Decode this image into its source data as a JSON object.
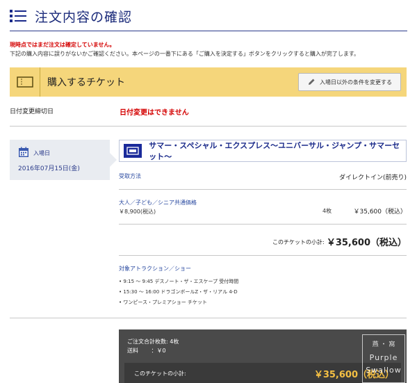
{
  "header": {
    "title": "注文内容の確認",
    "icon": "list-icon",
    "accent_color": "#1a2a7a"
  },
  "notice": {
    "warning": "現時点ではまだ注文は確定していません。",
    "instruction": "下記の購入内容に誤りがないかご確認ください。本ページの一番下にある「ご購入を決定する」ボタンをクリックすると購入が完了します。",
    "warning_color": "#d40000"
  },
  "ticket_section": {
    "title": "購入するチケット",
    "icon": "ticket-icon",
    "banner_color": "#f5d67b",
    "change_button": "入場日以外の条件を変更する",
    "change_button_icon": "pencil-icon"
  },
  "deadline": {
    "label": "日付変更締切日",
    "value": "日付変更はできません"
  },
  "entry": {
    "icon": "calendar-icon",
    "label": "入場日",
    "date": "2016年07月15日(金)"
  },
  "product": {
    "icon": "ticket-card-icon",
    "name": "サマー・スペシャル・エクスプレス〜ユニバーサル・ジャンプ・サマーセット〜"
  },
  "receipt": {
    "label": "受取方法",
    "value": "ダイレクトイン(前売り)"
  },
  "line_item": {
    "type": "大人／子ども／シニア共通価格",
    "unit_price": "￥8,900(税込)",
    "quantity": "4枚",
    "total": "￥35,600（税込）"
  },
  "subtotal": {
    "label": "このチケットの小計:",
    "value": "￥35,600（税込）"
  },
  "attractions": {
    "title": "対象アトラクション／ショー",
    "items": [
      "9:15 〜 9:45 デスノート・ザ・エスケープ 受付時間",
      "15:30 〜 16:00 ドラゴンボールZ・ザ・リアル 4-D",
      "ワンピース・プレミアショー チケット"
    ]
  },
  "summary": {
    "count_label": "ご注文合計枚数:",
    "count_value": "4枚",
    "shipping_label": "送料",
    "shipping_value": "：￥0",
    "inner_label": "このチケットの小計:",
    "inner_value": "￥35,600（税込）",
    "highlight_color": "#f5c043"
  },
  "watermark": {
    "line1": "燕 ・ 窩",
    "line2": "Purple",
    "line3": "Swallow"
  }
}
